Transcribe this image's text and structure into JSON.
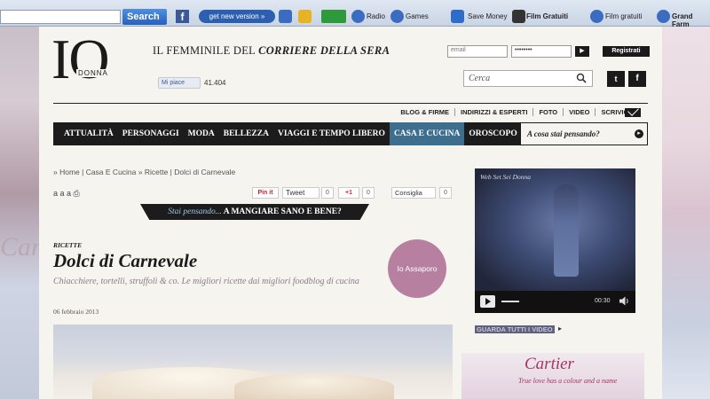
{
  "browser_toolbar": {
    "search_label": "Search »",
    "facebook_label": "f",
    "get_new_version": "get new version »",
    "radio": "Radio",
    "games": "Games",
    "save_money": "Save Money",
    "film_gratuiti_1": "Film Gratuiti",
    "film_gratuiti_2": "Film gratuiti",
    "grand_farm": "Grand Farm"
  },
  "header": {
    "logo_main": "IO",
    "logo_sub": "DONNA",
    "tagline_prefix": "IL FEMMINILE DEL ",
    "tagline_brand": "CORRIERE DELLA SERA",
    "like_label": "Mi piace",
    "like_count": "41.404",
    "email_placeholder": "email",
    "password_value": "••••••••",
    "login_arrow": "▶",
    "register_label": "Registrati",
    "search_placeholder": "Cerca",
    "twitter_label": "t",
    "facebook_label": "f"
  },
  "secondary_nav": [
    "BLOG & FIRME",
    "INDIRIZZI & ESPERTI",
    "FOTO",
    "VIDEO",
    "SCRIVICI"
  ],
  "main_nav": {
    "items": [
      "ATTUALITÀ",
      "PERSONAGGI",
      "MODA",
      "BELLEZZA",
      "VIAGGI E TEMPO LIBERO",
      "CASA E CUCINA",
      "OROSCOPO"
    ],
    "active_index": 5,
    "ask_label": "A cosa stai pensando?",
    "ask_icon": "▸"
  },
  "breadcrumb": "» Home |  Casa E Cucina » Ricette |  Dolci di Carnevale",
  "tools": "a a a  ⎙",
  "share": {
    "pin_label": "Pin it",
    "tweet_label": "Tweet",
    "tweet_count": "0",
    "gplus_label": "+1",
    "gplus_count": "0",
    "fb_label": "Consiglia",
    "fb_count": "0"
  },
  "banner": {
    "question": "Stai pensando...",
    "answer": " A MANGIARE SANO E BENE?"
  },
  "article": {
    "kicker": "RICETTE",
    "title": "Dolci di Carnevale",
    "subtitle": "Chiacchiere, tortelli, struffoli & co. Le migliori ricette dai migliori foodblog di cucina",
    "date": "06 febbraio 2013",
    "badge": "Io Assaporo"
  },
  "sidebar": {
    "video_title": "Web Set Sei Donna",
    "video_time": "00:30",
    "more_videos": "GUARDA TUTTI I VIDEO",
    "more_arrow": "▸",
    "ad_brand": "Cartier",
    "ad_slogan": "True love has a colour and a name"
  },
  "background": {
    "left_partial_text": "Car"
  },
  "colors": {
    "nav_bg": "#1c1c1c",
    "nav_active": "#3e6e8e",
    "badge": "#b77fa0",
    "subtitle": "#8a7a8c",
    "cartier": "#a13564"
  }
}
